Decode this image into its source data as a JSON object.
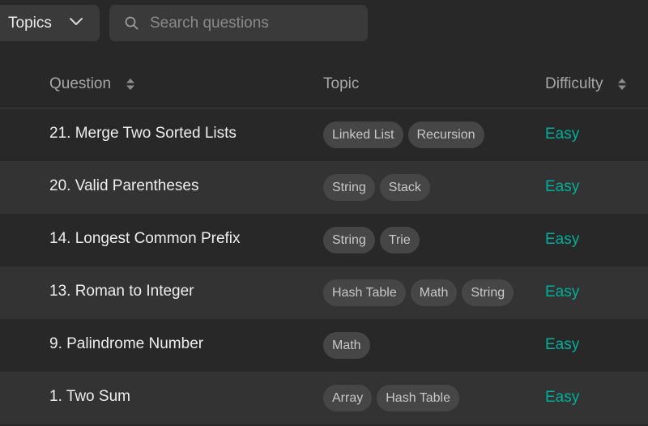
{
  "toolbar": {
    "topics_label": "Topics",
    "search_placeholder": "Search questions"
  },
  "columns": {
    "question": "Question",
    "topic": "Topic",
    "difficulty": "Difficulty"
  },
  "colors": {
    "background": "#282828",
    "row_alt": "#333333",
    "easy": "#00af9b",
    "tag_bg": "#464646"
  },
  "rows": [
    {
      "title": "21. Merge Two Sorted Lists",
      "tags": [
        "Linked List",
        "Recursion"
      ],
      "difficulty": "Easy"
    },
    {
      "title": "20. Valid Parentheses",
      "tags": [
        "String",
        "Stack"
      ],
      "difficulty": "Easy"
    },
    {
      "title": "14. Longest Common Prefix",
      "tags": [
        "String",
        "Trie"
      ],
      "difficulty": "Easy"
    },
    {
      "title": "13. Roman to Integer",
      "tags": [
        "Hash Table",
        "Math",
        "String"
      ],
      "difficulty": "Easy"
    },
    {
      "title": "9. Palindrome Number",
      "tags": [
        "Math"
      ],
      "difficulty": "Easy"
    },
    {
      "title": "1. Two Sum",
      "tags": [
        "Array",
        "Hash Table"
      ],
      "difficulty": "Easy"
    }
  ]
}
